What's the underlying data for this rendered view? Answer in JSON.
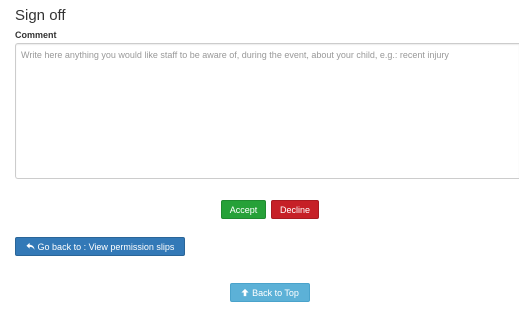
{
  "section": {
    "title": "Sign off",
    "comment_label": "Comment",
    "comment": {
      "value": "",
      "placeholder": "Write here anything you would like staff to be aware of, during the event, about your child, e.g.: recent injury"
    }
  },
  "actions": {
    "accept_label": "Accept",
    "decline_label": "Decline"
  },
  "navigation": {
    "back_label": "Go back to : View permission slips",
    "back_icon": "reply-icon",
    "top_label": "Back to Top",
    "top_icon": "arrow-up-icon"
  },
  "colors": {
    "accept": "#26a138",
    "decline": "#c62027",
    "back": "#3379b7",
    "top": "#5cb1d7"
  }
}
